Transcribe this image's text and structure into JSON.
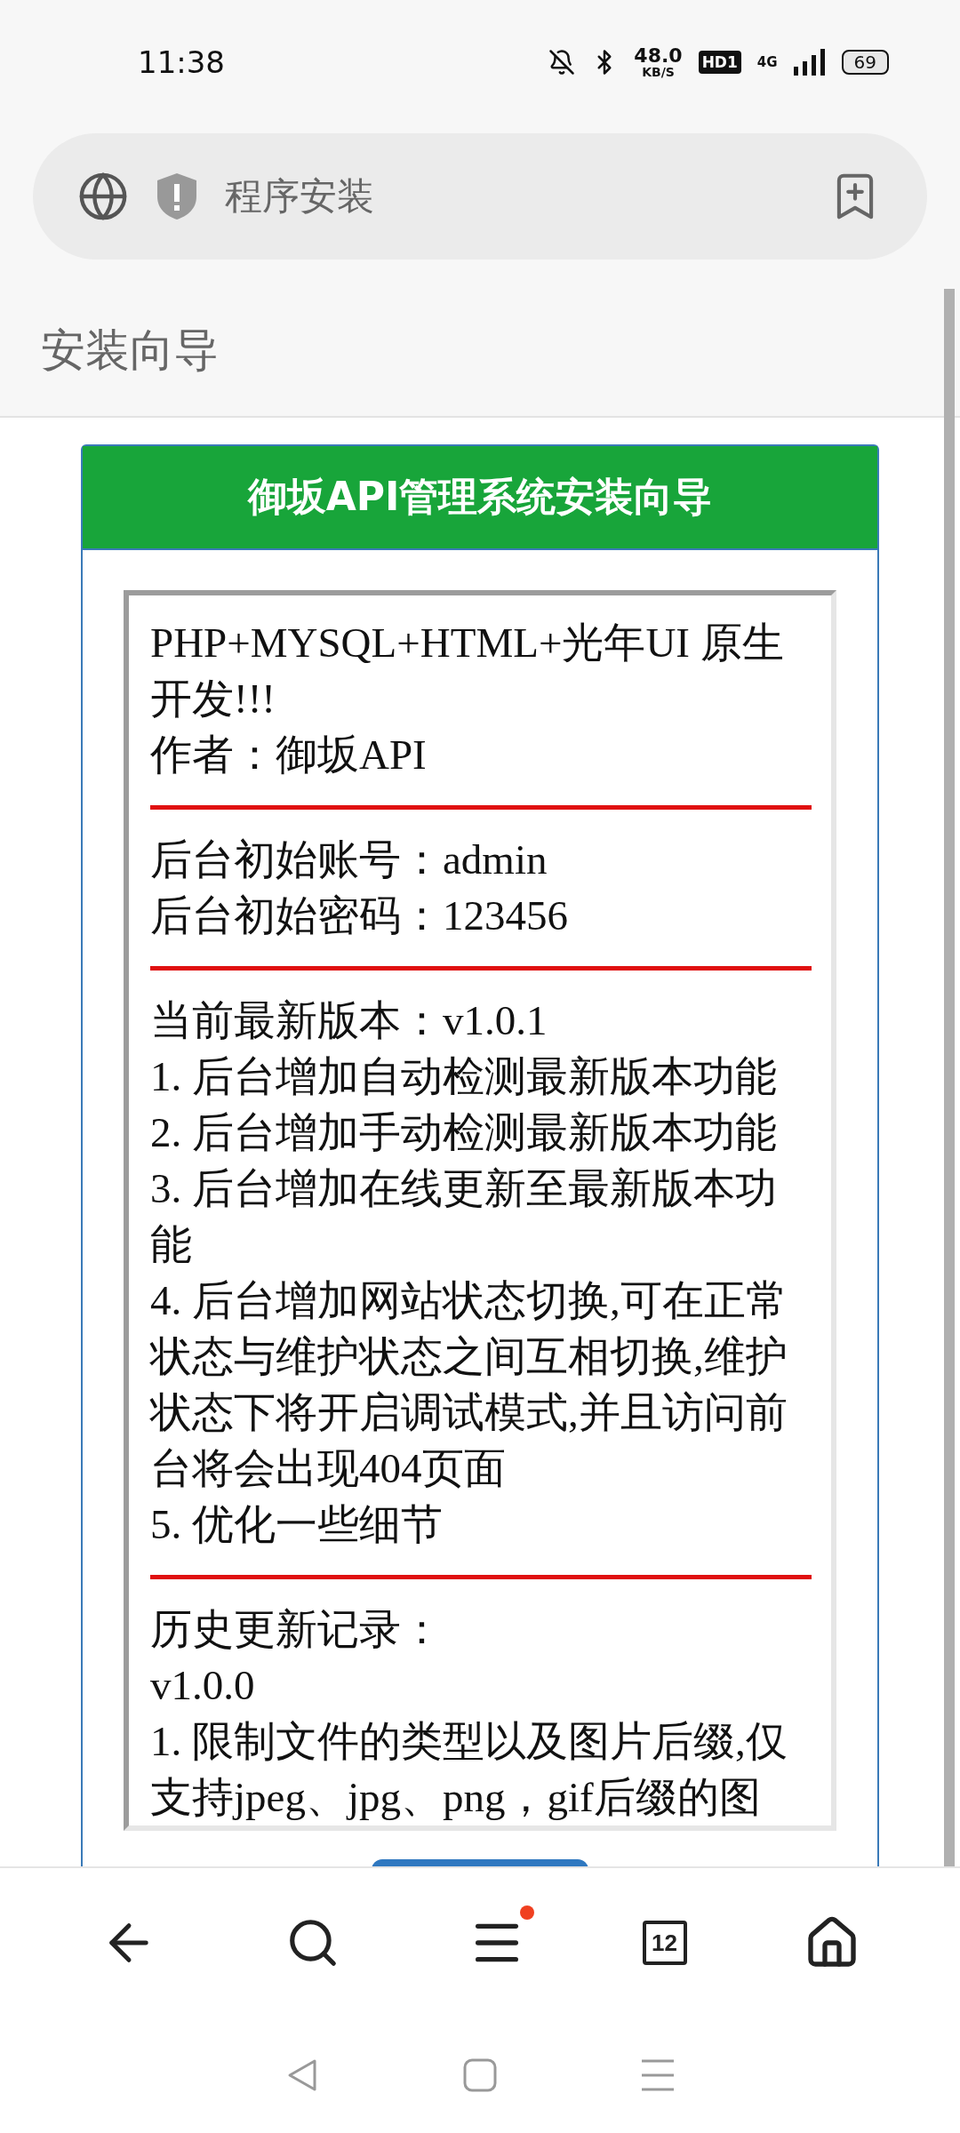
{
  "status_bar": {
    "time": "11:38",
    "net_speed": "48.0",
    "net_unit": "KB/S",
    "hd_badge": "HD1",
    "network": "4G",
    "battery": "69"
  },
  "address_bar": {
    "title": "程序安装"
  },
  "page_header": "安装向导",
  "card": {
    "title": "御坂API管理系统安装向导",
    "sections": [
      [
        "PHP+MYSQL+HTML+光年UI 原生开发!!!",
        "作者：御坂API"
      ],
      [
        "后台初始账号：admin",
        "后台初始密码：123456"
      ],
      [
        "当前最新版本：v1.0.1",
        "1. 后台增加自动检测最新版本功能",
        "2. 后台增加手动检测最新版本功能",
        "3. 后台增加在线更新至最新版本功能",
        "4. 后台增加网站状态切换,可在正常状态与维护状态之间互相切换,维护状态下将开启调试模式,并且访问前台将会出现404页面",
        "5. 优化一些细节"
      ],
      [
        "历史更新记录：",
        "v1.0.0",
        "1. 限制文件的类型以及图片后缀,仅支持jpeg、jpg、png，gif后缀的图"
      ]
    ]
  },
  "bottom_nav": {
    "tab_count": "12",
    "menu_badge": true
  }
}
